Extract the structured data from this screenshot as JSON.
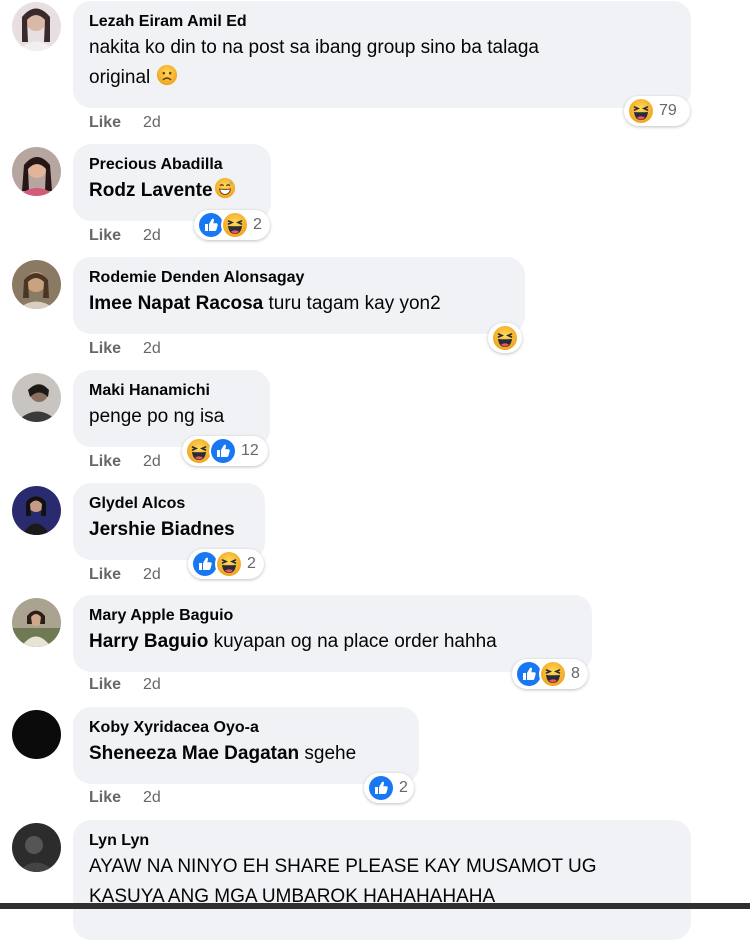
{
  "comments": [
    {
      "author": "Lezah Eiram Amil Ed",
      "text_line1": "nakita ko din to na post sa ibang group sino ba talaga",
      "text_line2": "original",
      "count": "79",
      "like": "Like",
      "time": "2d"
    },
    {
      "author": "Precious Abadilla",
      "mention": "Rodz Lavente",
      "count": "2",
      "like": "Like",
      "time": "2d"
    },
    {
      "author": "Rodemie Denden Alonsagay",
      "mention": "Imee Napat Racosa",
      "text": " turu tagam kay yon2",
      "like": "Like",
      "time": "2d"
    },
    {
      "author": "Maki Hanamichi",
      "text": "penge po ng isa",
      "count": "12",
      "like": "Like",
      "time": "2d"
    },
    {
      "author": "Glydel Alcos",
      "mention": "Jershie Biadnes",
      "count": "2",
      "like": "Like",
      "time": "2d"
    },
    {
      "author": "Mary Apple Baguio",
      "mention": "Harry Baguio",
      "text": " kuyapan og na place order hahha",
      "count": "8",
      "like": "Like",
      "time": "2d"
    },
    {
      "author": "Koby Xyridacea Oyo-a",
      "mention": "Sheneeza Mae Dagatan",
      "text": " sgehe",
      "count": "2",
      "like": "Like",
      "time": "2d"
    },
    {
      "author": "Lyn Lyn",
      "text_line1": "AYAW NA NINYO EH SHARE PLEASE KAY MUSAMOT UG",
      "text_line2": "KASUYA ANG MGA UMBAROK HAHAHAHAHA"
    }
  ],
  "icons": {
    "like": "like-reaction-icon",
    "haha": "haha-reaction-icon",
    "sad": "sad-emoji-icon",
    "grin": "grin-sweat-emoji-icon"
  },
  "colors": {
    "bubble": "#f0f2f5",
    "like_blue": "#1877f2",
    "haha_yellow": "#f7b125",
    "meta_gray": "#65676b"
  }
}
